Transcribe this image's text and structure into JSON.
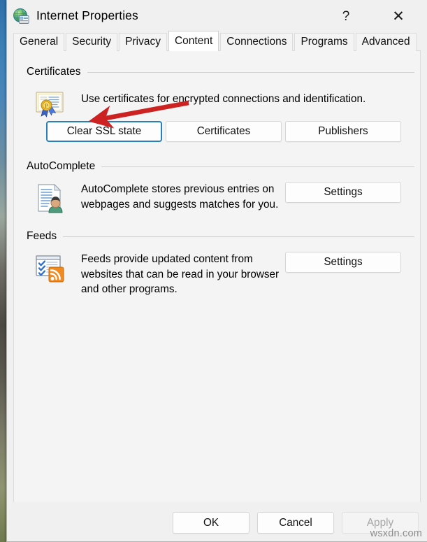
{
  "window": {
    "title": "Internet Properties",
    "icon": "internet-properties-globe-icon",
    "help_glyph": "?",
    "close_glyph": "✕"
  },
  "tabs": [
    {
      "label": "General",
      "selected": false
    },
    {
      "label": "Security",
      "selected": false
    },
    {
      "label": "Privacy",
      "selected": false
    },
    {
      "label": "Content",
      "selected": true
    },
    {
      "label": "Connections",
      "selected": false
    },
    {
      "label": "Programs",
      "selected": false
    },
    {
      "label": "Advanced",
      "selected": false
    }
  ],
  "groups": {
    "certificates": {
      "title": "Certificates",
      "icon": "certificate-seal-icon",
      "description": "Use certificates for encrypted connections and identification.",
      "buttons": [
        {
          "label": "Clear SSL state",
          "focused": true
        },
        {
          "label": "Certificates",
          "focused": false
        },
        {
          "label": "Publishers",
          "focused": false
        }
      ]
    },
    "autocomplete": {
      "title": "AutoComplete",
      "icon": "autocomplete-form-user-icon",
      "description": "AutoComplete stores previous entries on webpages and suggests matches for you.",
      "settings_label": "Settings"
    },
    "feeds": {
      "title": "Feeds",
      "icon": "rss-feeds-icon",
      "description": "Feeds provide updated content from websites that can be read in your browser and other programs.",
      "settings_label": "Settings"
    }
  },
  "footer": {
    "ok_label": "OK",
    "cancel_label": "Cancel",
    "apply_label": "Apply",
    "apply_disabled": true
  },
  "annotation": {
    "type": "arrow",
    "color": "#cc2222",
    "points_to": "Clear SSL state"
  },
  "watermark": "wsxdn.com"
}
